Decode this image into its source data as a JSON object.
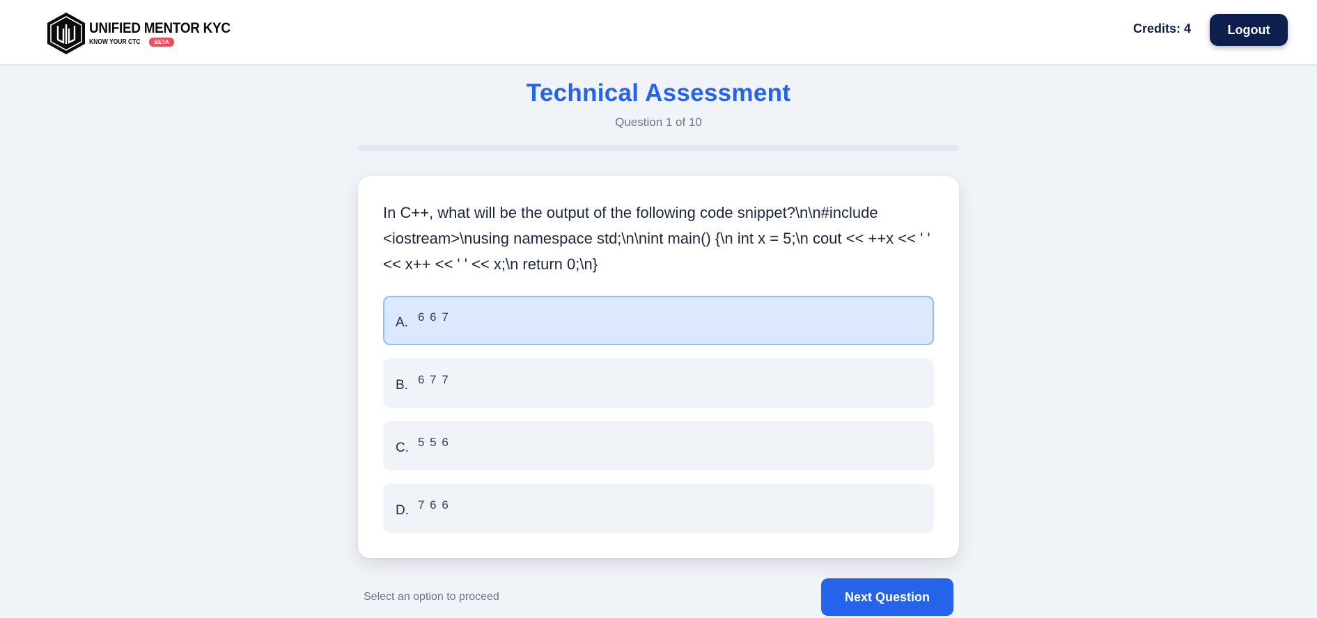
{
  "header": {
    "logo_title": "UNIFIED MENTOR KYC",
    "logo_tagline": "KNOW YOUR CTC",
    "logo_badge": "BETA",
    "credits_label": "Credits: 4",
    "logout_label": "Logout"
  },
  "assessment": {
    "title": "Technical Assessment",
    "progress_text": "Question 1 of 10",
    "progress_fraction": 0.0
  },
  "question": {
    "text": "In C++, what will be the output of the following code snippet?\\n\\n#include <iostream>\\nusing namespace std;\\n\\nint main() {\\n int x = 5;\\n cout << ++x << ' ' << x++ << ' ' << x;\\n return 0;\\n}",
    "options": [
      {
        "letter": "A.",
        "text": "6 6 7",
        "selected": true
      },
      {
        "letter": "B.",
        "text": "6 7 7",
        "selected": false
      },
      {
        "letter": "C.",
        "text": "5 5 6",
        "selected": false
      },
      {
        "letter": "D.",
        "text": "7 6 6",
        "selected": false
      }
    ]
  },
  "footer": {
    "hint": "Select an option to proceed",
    "next_label": "Next Question"
  },
  "colors": {
    "accent": "#2563eb",
    "navy": "#0f1f4d",
    "badge": "#ef4d5a",
    "selected_bg": "#dbe8fd"
  }
}
